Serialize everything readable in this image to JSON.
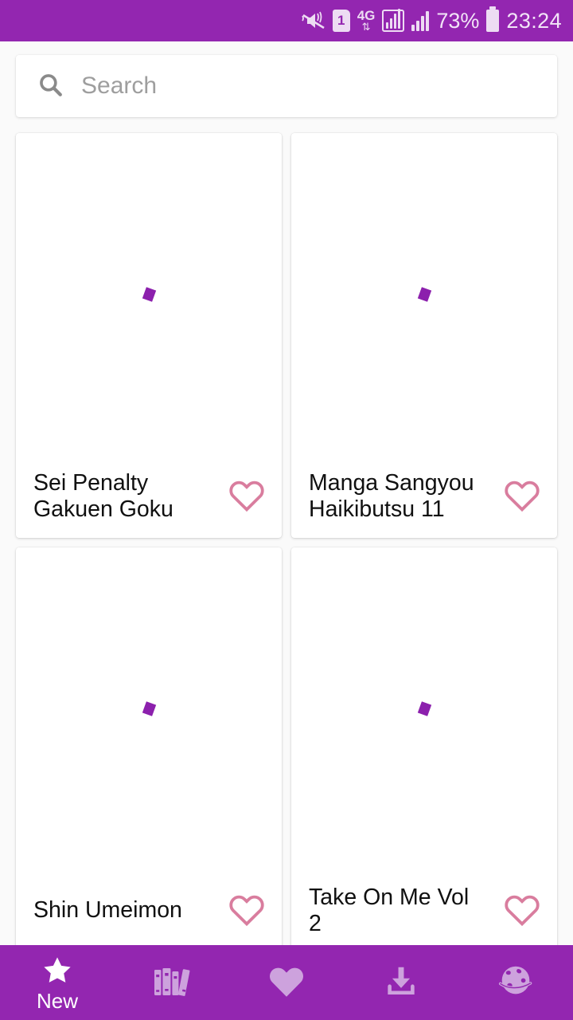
{
  "status_bar": {
    "mute_icon": "vibrate-mute-icon",
    "sim_icon": "sim-card-1-icon",
    "sim_label": "1",
    "network_label": "4G",
    "network_arrows": "⇅",
    "signal_icon_boxed": "signal-bars-boxed-icon",
    "signal_icon": "signal-bars-icon",
    "battery_percent": "73%",
    "battery_icon": "battery-icon",
    "time": "23:24",
    "background_color": "#9326b0",
    "foreground_color": "#f2e4f7"
  },
  "search": {
    "icon": "search-icon",
    "placeholder": "Search",
    "value": ""
  },
  "grid": {
    "cards": [
      {
        "title": "Sei Penalty Gakuen Goku",
        "favorite_icon": "heart-outline-icon",
        "favorited": false,
        "cover_state": "loading"
      },
      {
        "title": "Manga Sangyou Haikibutsu 11",
        "favorite_icon": "heart-outline-icon",
        "favorited": false,
        "cover_state": "loading"
      },
      {
        "title": "Shin Umeimon",
        "favorite_icon": "heart-outline-icon",
        "favorited": false,
        "cover_state": "loading"
      },
      {
        "title": "Take On Me Vol 2",
        "favorite_icon": "heart-outline-icon",
        "favorited": false,
        "cover_state": "loading"
      }
    ]
  },
  "bottom_nav": {
    "items": [
      {
        "label": "New",
        "icon": "star-icon",
        "active": true
      },
      {
        "label": "",
        "icon": "books-library-icon",
        "active": false
      },
      {
        "label": "",
        "icon": "heart-filled-icon",
        "active": false
      },
      {
        "label": "",
        "icon": "download-icon",
        "active": false
      },
      {
        "label": "",
        "icon": "globe-icon",
        "active": false
      }
    ],
    "background_color": "#9326b0",
    "active_color": "#ffffff",
    "inactive_color": "#cda2dd"
  },
  "theme": {
    "accent_purple": "#9326b0",
    "heart_pink": "#d97d9e",
    "page_background": "#fafafa",
    "card_background": "#ffffff"
  }
}
